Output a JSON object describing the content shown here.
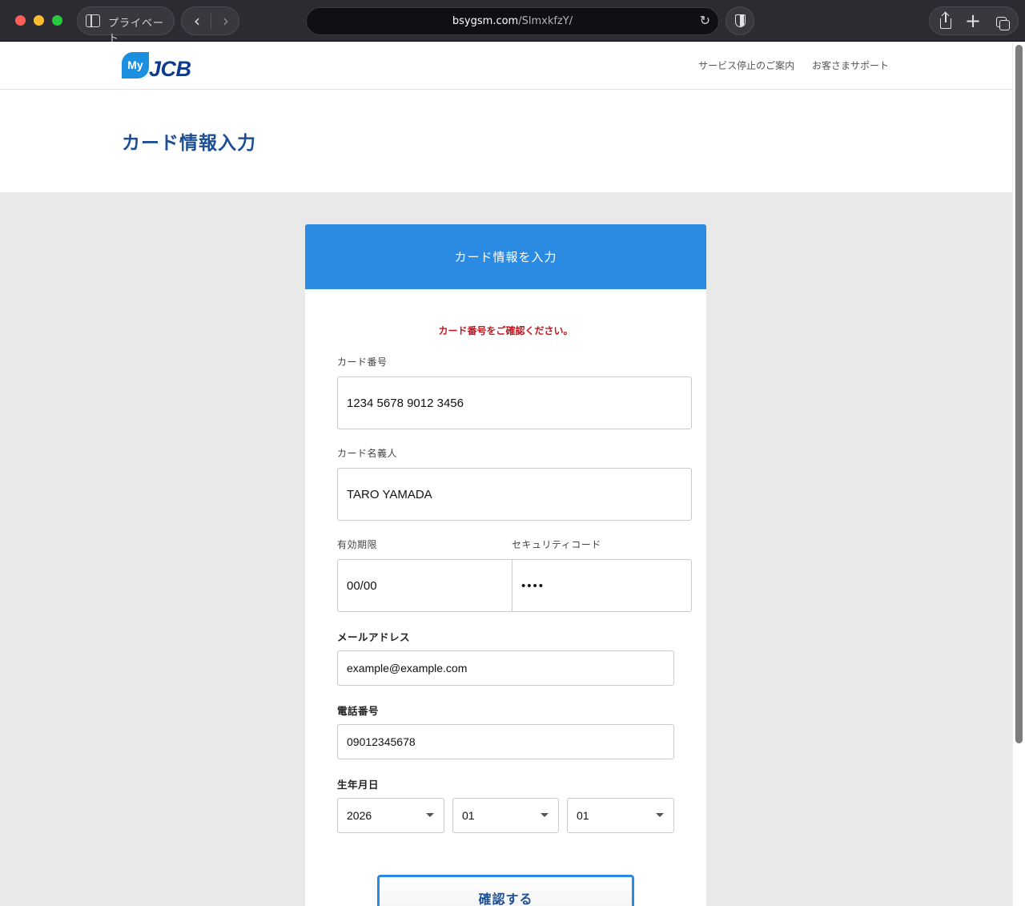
{
  "browser": {
    "private_label": "プライベート",
    "url_host": "bsygsm.com",
    "url_path": "/SlmxkfzY/",
    "icons": [
      "sidebar-icon",
      "back-icon",
      "forward-icon",
      "reload-icon",
      "shield-icon",
      "share-icon",
      "new-tab-icon",
      "tabs-overview-icon"
    ]
  },
  "header": {
    "logo_my": "My",
    "logo_jcb": "JCB",
    "links": [
      "サービス停止のご案内",
      "お客さまサポート"
    ]
  },
  "page_title": "カード情報入力",
  "form": {
    "heading": "カード情報を入力",
    "error": "カード番号をご確認ください。",
    "card_number": {
      "label": "カード番号",
      "value": "1234 5678 9012 3456"
    },
    "card_holder": {
      "label": "カード名義人",
      "value": "TARO YAMADA"
    },
    "expiry": {
      "label": "有効期限",
      "value": "00/00"
    },
    "cvv": {
      "label": "セキュリティコード",
      "value": "••••"
    },
    "email": {
      "label": "メールアドレス",
      "value": "example@example.com"
    },
    "phone": {
      "label": "電話番号",
      "value": "09012345678"
    },
    "birth": {
      "label": "生年月日",
      "year": "2026",
      "month": "01",
      "day": "01"
    },
    "submit_label": "確認する"
  },
  "colors": {
    "accent": "#2b8ae2",
    "title": "#1c4f93",
    "error": "#c0161d",
    "background": "#e9e9e9"
  }
}
